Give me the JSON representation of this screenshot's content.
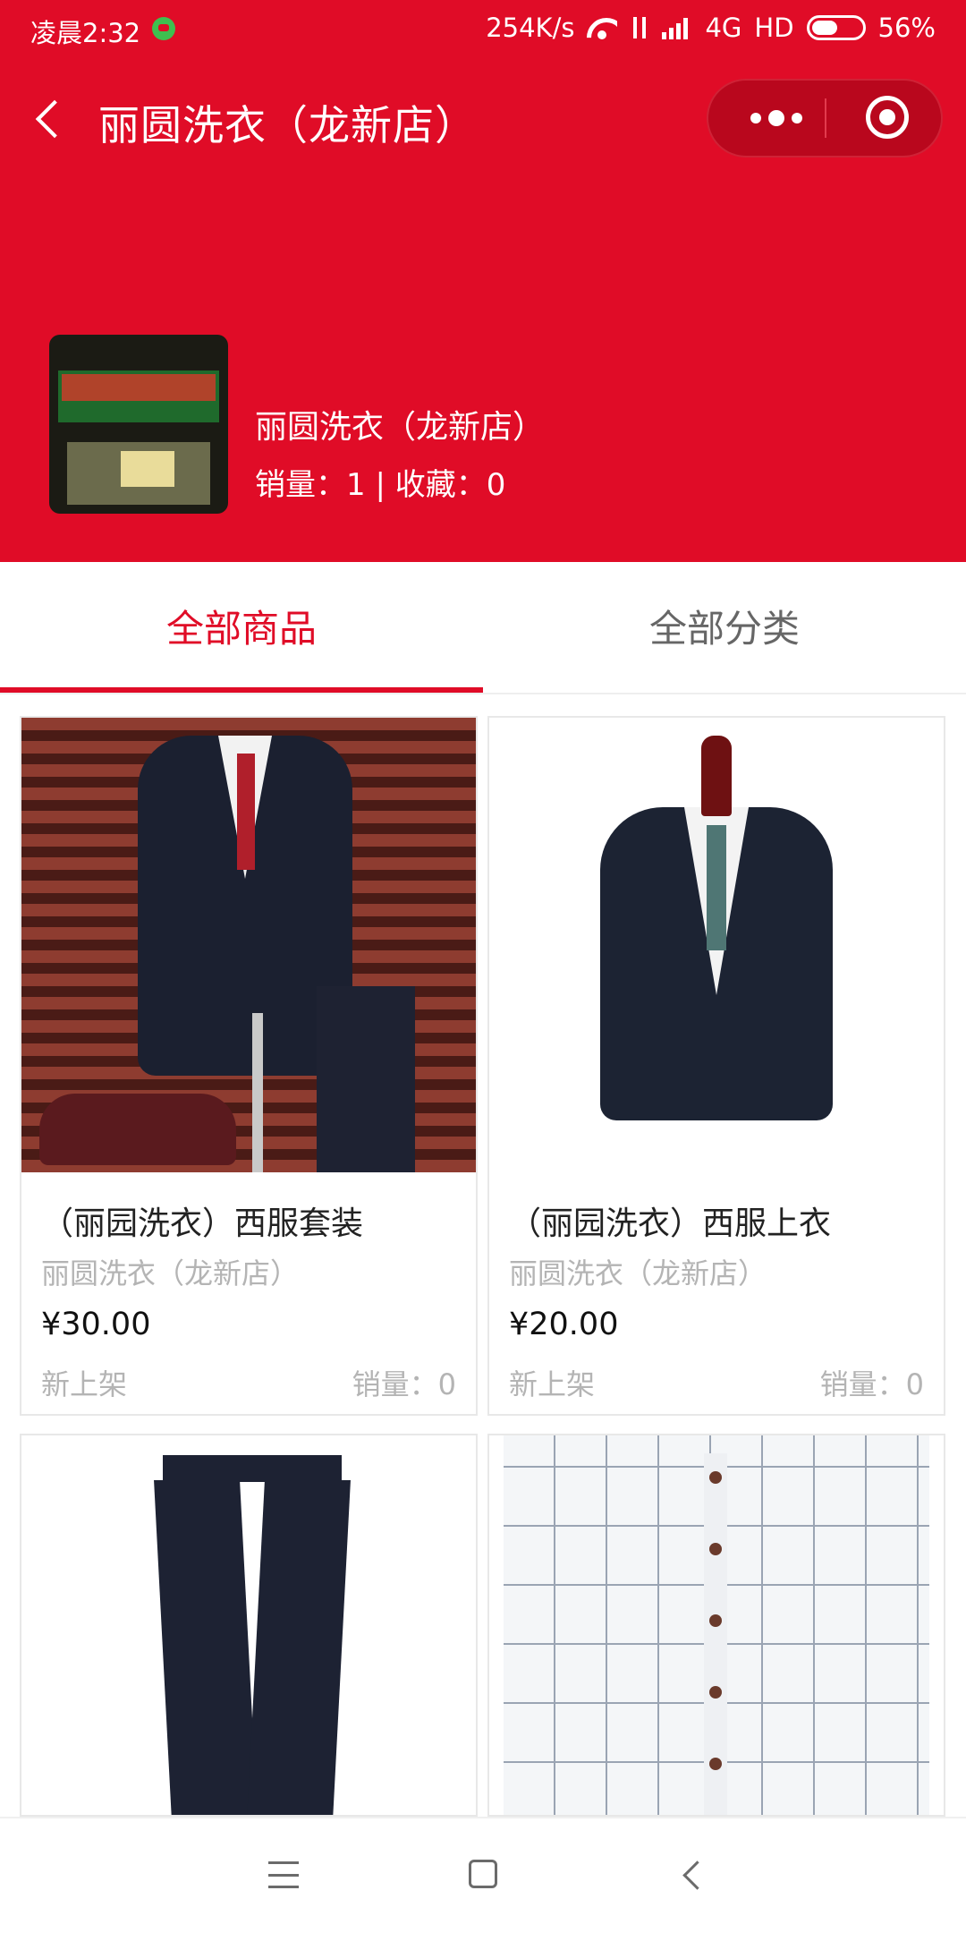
{
  "status_bar": {
    "time": "凌晨2:32",
    "speed": "254K/s",
    "network": "4G",
    "hd": "HD",
    "battery": "56%",
    "battery_level": 0.56
  },
  "nav": {
    "title": "丽圆洗衣（龙新店）"
  },
  "shop": {
    "name": "丽圆洗衣（龙新店）",
    "stats": "销量：1 | 收藏：0"
  },
  "tabs": [
    {
      "label": "全部商品",
      "active": true
    },
    {
      "label": "全部分类",
      "active": false
    }
  ],
  "colors": {
    "brand": "#e00c27",
    "muted": "#b4b4b4"
  },
  "products": [
    {
      "name": "（丽园洗衣）西服套装",
      "shop": "丽圆洗衣（龙新店）",
      "price": "¥30.00",
      "tag": "新上架",
      "sales": "销量：0",
      "image": "suit-set"
    },
    {
      "name": "（丽园洗衣）西服上衣",
      "shop": "丽圆洗衣（龙新店）",
      "price": "¥20.00",
      "tag": "新上架",
      "sales": "销量：0",
      "image": "suit-jacket"
    },
    {
      "image": "trousers"
    },
    {
      "image": "plaid-shirt"
    }
  ]
}
